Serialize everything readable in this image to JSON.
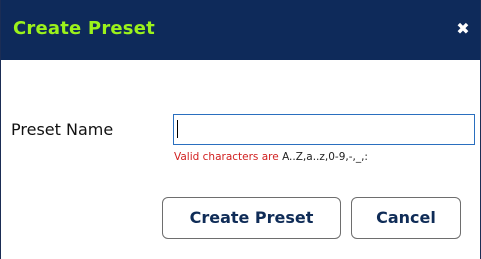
{
  "dialog": {
    "title": "Create Preset",
    "close_icon": "close-icon",
    "close_glyph": "✖"
  },
  "form": {
    "preset_name_label": "Preset Name",
    "preset_name_value": "",
    "hint_prefix": "Valid characters are",
    "hint_chars": "A..Z,a..z,0-9,-,_,:"
  },
  "buttons": {
    "create_label": "Create Preset",
    "cancel_label": "Cancel"
  },
  "colors": {
    "titlebar_bg": "#0e2a5a",
    "title_text": "#9bf21b",
    "hint_red": "#d11f1f",
    "input_border": "#2a6fbf",
    "button_text": "#0f2c57"
  }
}
